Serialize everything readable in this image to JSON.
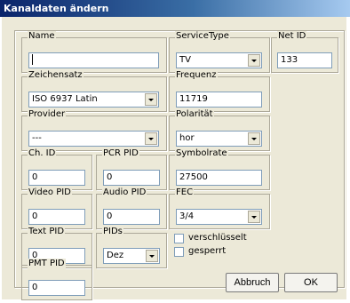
{
  "window": {
    "title": "Kanaldaten ändern"
  },
  "fields": {
    "name": {
      "label": "Name",
      "value": ""
    },
    "service_type": {
      "label": "ServiceType",
      "value": "TV"
    },
    "net_id": {
      "label": "Net ID",
      "value": "133"
    },
    "zeichensatz": {
      "label": "Zeichensatz",
      "value": "ISO 6937 Latin"
    },
    "frequenz": {
      "label": "Frequenz",
      "value": "11719"
    },
    "provider": {
      "label": "Provider",
      "value": "---"
    },
    "polaritaet": {
      "label": "Polarität",
      "value": "hor"
    },
    "ch_id": {
      "label": "Ch. ID",
      "value": "0"
    },
    "pcr_pid": {
      "label": "PCR PID",
      "value": "0"
    },
    "symbolrate": {
      "label": "Symbolrate",
      "value": "27500"
    },
    "video_pid": {
      "label": "Video PID",
      "value": "0"
    },
    "audio_pid": {
      "label": "Audio PID",
      "value": "0"
    },
    "fec": {
      "label": "FEC",
      "value": "3/4"
    },
    "text_pid": {
      "label": "Text PID",
      "value": "0"
    },
    "pids": {
      "label": "PIDs",
      "value": "Dez"
    },
    "pmt_pid": {
      "label": "PMT PID",
      "value": "0"
    }
  },
  "checkboxes": {
    "verschluesselt": {
      "label": "verschlüsselt",
      "checked": false
    },
    "gesperrt": {
      "label": "gesperrt",
      "checked": false
    }
  },
  "buttons": {
    "cancel": "Abbruch",
    "ok": "OK"
  },
  "colors": {
    "title_start": "#0a246a",
    "title_end": "#a6caf0",
    "dialog_bg": "#ece9d8",
    "field_border": "#7f9db9"
  }
}
